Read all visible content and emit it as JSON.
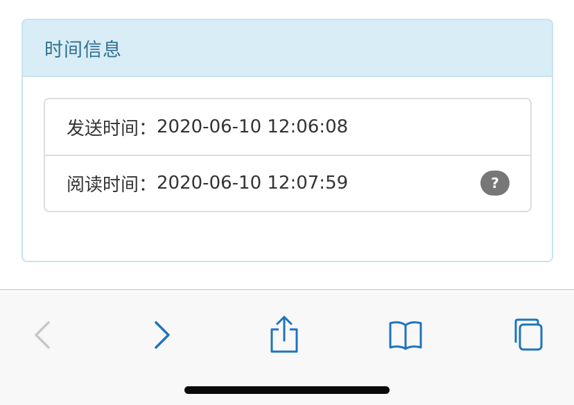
{
  "panel": {
    "title": "时间信息",
    "rows": [
      {
        "label": "发送时间：",
        "value": "2020-06-10 12:06:08"
      },
      {
        "label": "阅读时间：",
        "value": "2020-06-10 12:07:59",
        "help_badge": "?"
      }
    ]
  },
  "toolbar": {
    "accent_color": "#1e73be",
    "disabled_color": "#c7c7cc",
    "buttons": [
      {
        "name": "back",
        "icon": "chevron-left-icon",
        "enabled": false
      },
      {
        "name": "forward",
        "icon": "chevron-right-icon",
        "enabled": true
      },
      {
        "name": "share",
        "icon": "share-icon",
        "enabled": true
      },
      {
        "name": "bookmarks",
        "icon": "book-icon",
        "enabled": true
      },
      {
        "name": "tabs",
        "icon": "tabs-icon",
        "enabled": true
      }
    ]
  }
}
